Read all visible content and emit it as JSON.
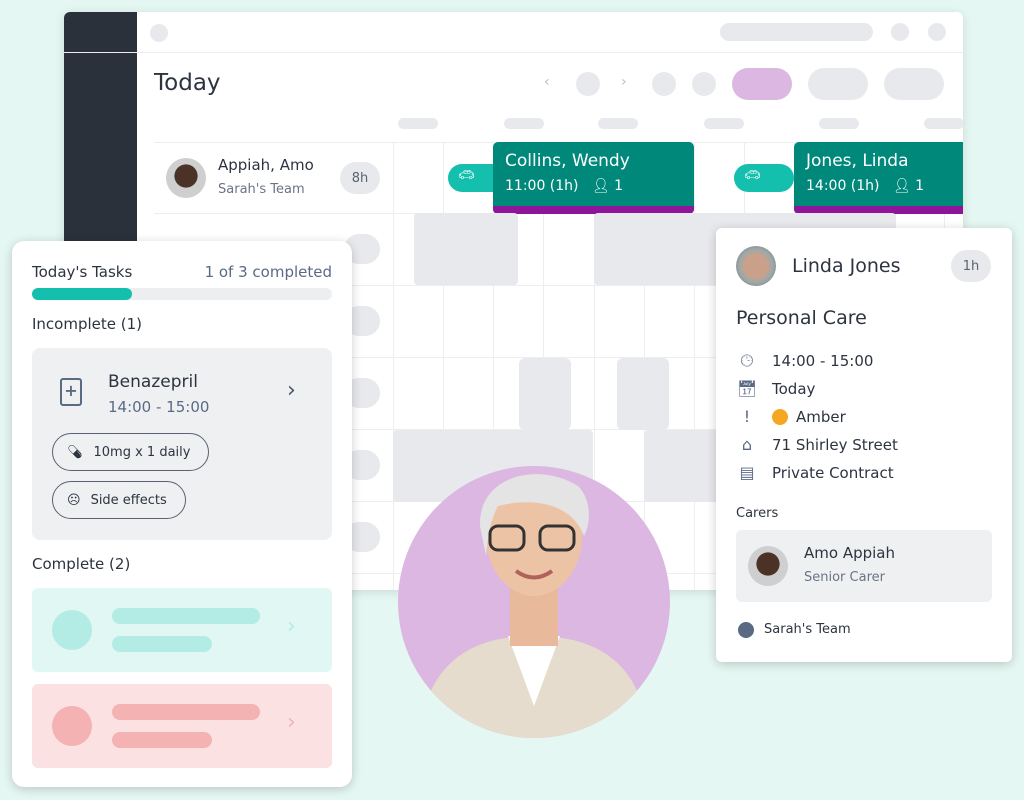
{
  "schedule": {
    "title": "Today",
    "carer": {
      "name": "Appiah, Amo",
      "team": "Sarah's Team",
      "hours": "8h"
    },
    "visits": [
      {
        "client": "Collins, Wendy",
        "time": "11:00 (1h)",
        "carers": "1"
      },
      {
        "client": "Jones, Linda",
        "time": "14:00 (1h)",
        "carers": "1"
      }
    ],
    "colors": {
      "visit": "#00897b",
      "travel": "#14bfae",
      "status_bar": "#8e1599",
      "active_filter": "#dbb7e2"
    }
  },
  "tasks": {
    "title": "Today's Tasks",
    "progress_text": "1 of 3 completed",
    "progress": 0.333,
    "incomplete_label": "Incomplete (1)",
    "task": {
      "name": "Benazepril",
      "time": "14:00 - 15:00",
      "dose": "10mg x 1 daily",
      "side_effects": "Side effects"
    },
    "complete_label": "Complete (2)"
  },
  "detail": {
    "client": "Linda Jones",
    "duration": "1h",
    "service": "Personal Care",
    "time": "14:00 - 15:00",
    "date": "Today",
    "risk": "Amber",
    "risk_color": "#f5a623",
    "address": "71 Shirley Street",
    "contract": "Private Contract",
    "carers_label": "Carers",
    "carer": {
      "name": "Amo Appiah",
      "role": "Senior Carer"
    },
    "team": "Sarah's Team"
  }
}
